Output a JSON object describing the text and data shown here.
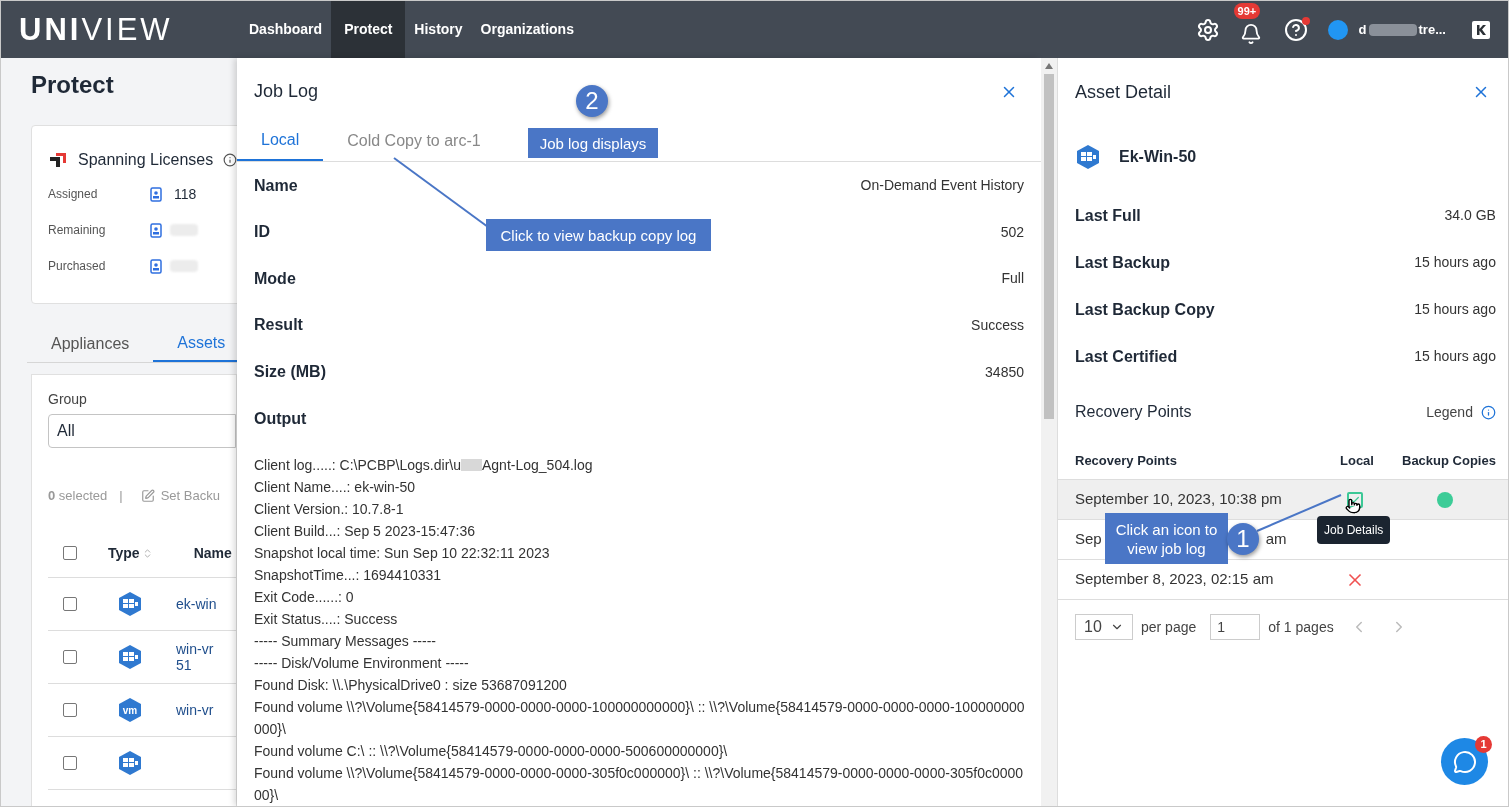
{
  "topbar": {
    "logo_bold": "UNI",
    "logo_light": "VIEW",
    "nav": [
      {
        "label": "Dashboard",
        "selected": false
      },
      {
        "label": "Protect",
        "selected": true
      },
      {
        "label": "History",
        "selected": false
      },
      {
        "label": "Organizations",
        "selected": false
      }
    ],
    "notification_badge": "99+",
    "help_dot": true,
    "user_start": "d",
    "user_end": "tre..."
  },
  "page": {
    "title": "Protect",
    "licenses": {
      "title": "Spanning Licenses",
      "rows": [
        {
          "label": "Assigned",
          "value": "118"
        },
        {
          "label": "Remaining"
        },
        {
          "label": "Purchased"
        }
      ]
    },
    "tabs": [
      {
        "label": "Appliances",
        "selected": false
      },
      {
        "label": "Assets",
        "selected": true
      }
    ],
    "group": {
      "label": "Group",
      "value": "All"
    },
    "selection": {
      "count": "0",
      "text": "selected",
      "divider": "|",
      "action": "Set Backu"
    },
    "table": {
      "select_all_checked": false,
      "columns": [
        "Type",
        "Name"
      ],
      "rows": [
        {
          "kind": "windows",
          "checked": false,
          "name": [
            "ek-win"
          ]
        },
        {
          "kind": "windows",
          "checked": false,
          "name": [
            "win-vr",
            "51"
          ]
        },
        {
          "kind": "vm",
          "label": "vm",
          "checked": false,
          "name": [
            "win-vr"
          ]
        },
        {
          "kind": "windows",
          "checked": false,
          "name": []
        }
      ]
    }
  },
  "job_log": {
    "title": "Job Log",
    "tabs": [
      {
        "label": "Local",
        "selected": true
      },
      {
        "label": "Cold Copy to arc-1",
        "selected": false
      }
    ],
    "fields": [
      {
        "label": "Name",
        "value": "On-Demand Event History"
      },
      {
        "label": "ID",
        "value": "502"
      },
      {
        "label": "Mode",
        "value": "Full"
      },
      {
        "label": "Result",
        "value": "Success"
      },
      {
        "label": "Size (MB)",
        "value": "34850"
      }
    ],
    "output_label": "Output",
    "output": [
      "Client log.....: C:\\PCBP\\Logs.dir\\u",
      "Agnt-Log_504.log",
      "Client Name....: ek-win-50",
      "Client Version.: 10.7.8-1",
      "Client Build...: Sep  5 2023-15:47:36",
      "Snapshot local time: Sun Sep 10 22:32:11 2023",
      "SnapshotTime...: 1694410331",
      "Exit Code......: 0",
      "Exit Status....: Success",
      "----- Summary Messages -----",
      "----- Disk/Volume Environment -----",
      "Found Disk: \\\\.\\PhysicalDrive0 : size 53687091200",
      "Found volume \\\\?\\Volume{58414579-0000-0000-0000-100000000000}\\ :: \\\\?\\Volume{58414579-0000-0000-0000-100000000000}\\",
      "Found volume C:\\ :: \\\\?\\Volume{58414579-0000-0000-0000-500600000000}\\",
      "Found volume \\\\?\\Volume{58414579-0000-0000-0000-305f0c000000}\\ :: \\\\?\\Volume{58414579-0000-0000-0000-305f0c000000}\\"
    ]
  },
  "asset_detail": {
    "title": "Asset Detail",
    "asset": {
      "kind": "windows",
      "name": "Ek-Win-50"
    },
    "fields": [
      {
        "label": "Last Full",
        "value": "34.0 GB"
      },
      {
        "label": "Last Backup",
        "value": "15 hours ago"
      },
      {
        "label": "Last Backup Copy",
        "value": "15 hours ago"
      },
      {
        "label": "Last Certified",
        "value": "15 hours ago"
      }
    ],
    "recovery_title": "Recovery Points",
    "legend": "Legend",
    "columns": [
      "Recovery Points",
      "Local",
      "Backup Copies"
    ],
    "rows": [
      {
        "date": "September 10, 2023, 10:38 pm",
        "local": {
          "kind": "check"
        },
        "copy": {
          "kind": "dot",
          "color": "#3ccc97"
        },
        "highlighted": true,
        "tooltip": "Job Details"
      },
      {
        "date": "Sep",
        "date_tail": "am",
        "highlighted": false
      },
      {
        "date": "September 8, 2023, 02:15 am",
        "local": {
          "kind": "cross"
        },
        "highlighted": false
      }
    ],
    "pagination": {
      "per_page_value": "10",
      "per_page_label": "per page",
      "page": "1",
      "of_pages": "of 1 pages"
    }
  },
  "callouts": [
    {
      "kind": "number",
      "text": "2"
    },
    {
      "kind": "box",
      "text": "Job log displays"
    },
    {
      "kind": "box",
      "text": "Click to view backup copy log"
    },
    {
      "kind": "box",
      "text": "Click an icon to view job log"
    },
    {
      "kind": "number",
      "text": "1"
    }
  ],
  "chat": {
    "badge": "1"
  }
}
